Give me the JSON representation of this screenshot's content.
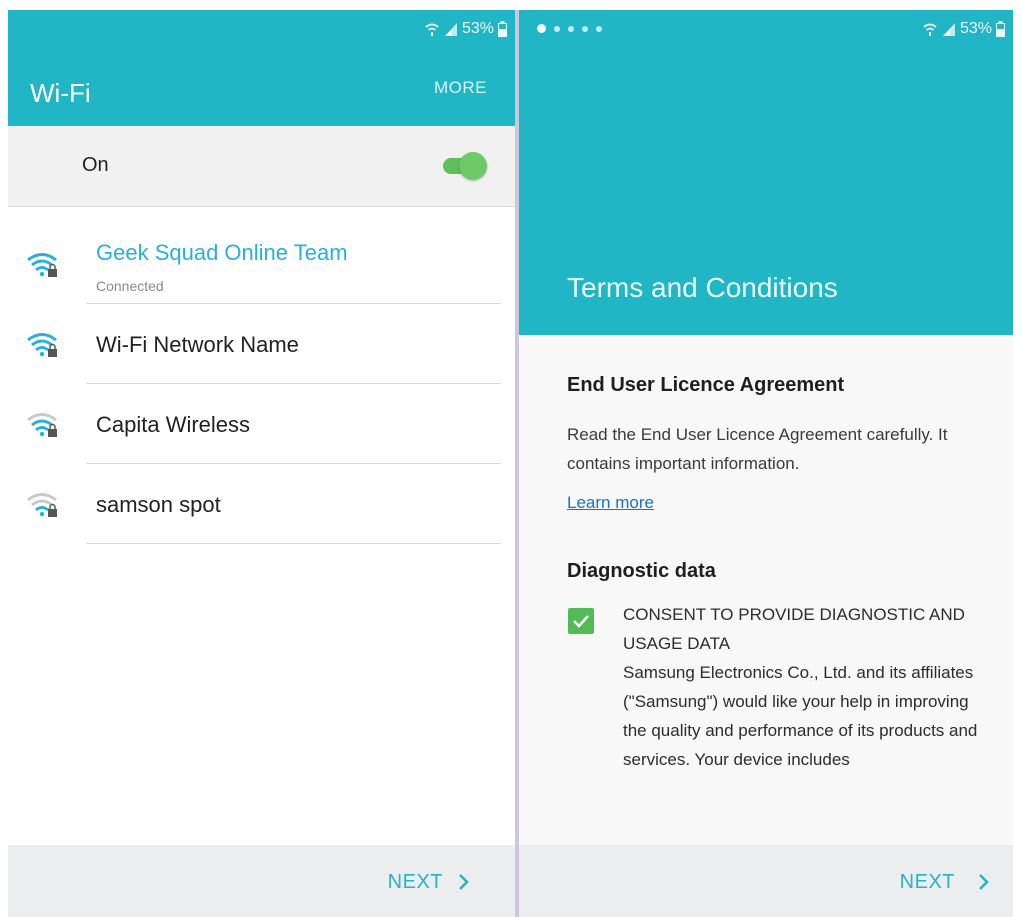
{
  "status_bar": {
    "battery_pct": "53%"
  },
  "wifi_screen": {
    "title": "Wi-Fi",
    "more_label": "MORE",
    "toggle_label": "On",
    "toggle_on": true,
    "networks": [
      {
        "name": "Geek Squad Online Team",
        "status": "Connected",
        "signal": "strong",
        "secured": true,
        "connected": true
      },
      {
        "name": "Wi-Fi Network Name",
        "signal": "strong",
        "secured": true,
        "connected": false
      },
      {
        "name": "Capita Wireless",
        "signal": "medium",
        "secured": true,
        "connected": false
      },
      {
        "name": "samson spot",
        "signal": "weak",
        "secured": true,
        "connected": false
      }
    ],
    "next_label": "NEXT"
  },
  "terms_screen": {
    "page_indicator": {
      "total": 5,
      "current": 1
    },
    "title": "Terms and Conditions",
    "eula_heading": "End User Licence Agreement",
    "eula_text": "Read the End User Licence Agreement carefully. It contains important information.",
    "learn_more": "Learn more",
    "diagnostic_heading": "Diagnostic data",
    "consent_checked": true,
    "consent_title": "CONSENT TO PROVIDE DIAGNOSTIC AND USAGE DATA",
    "consent_body": "Samsung Electronics Co., Ltd. and its affiliates (\"Samsung\") would like your help in improving the quality and performance of its products and services. Your device includes",
    "next_label": "NEXT"
  },
  "colors": {
    "header_teal": "#21b6c5",
    "accent_blue": "#2ab0d8",
    "toggle_green": "#5fbf5a",
    "checkbox_green": "#52bb55",
    "link_blue": "#1a73c8"
  },
  "icons": [
    "wifi-signal-icon",
    "cell-signal-icon",
    "battery-icon",
    "wifi-lock-icon",
    "chevron-right-icon",
    "checkmark-icon"
  ]
}
